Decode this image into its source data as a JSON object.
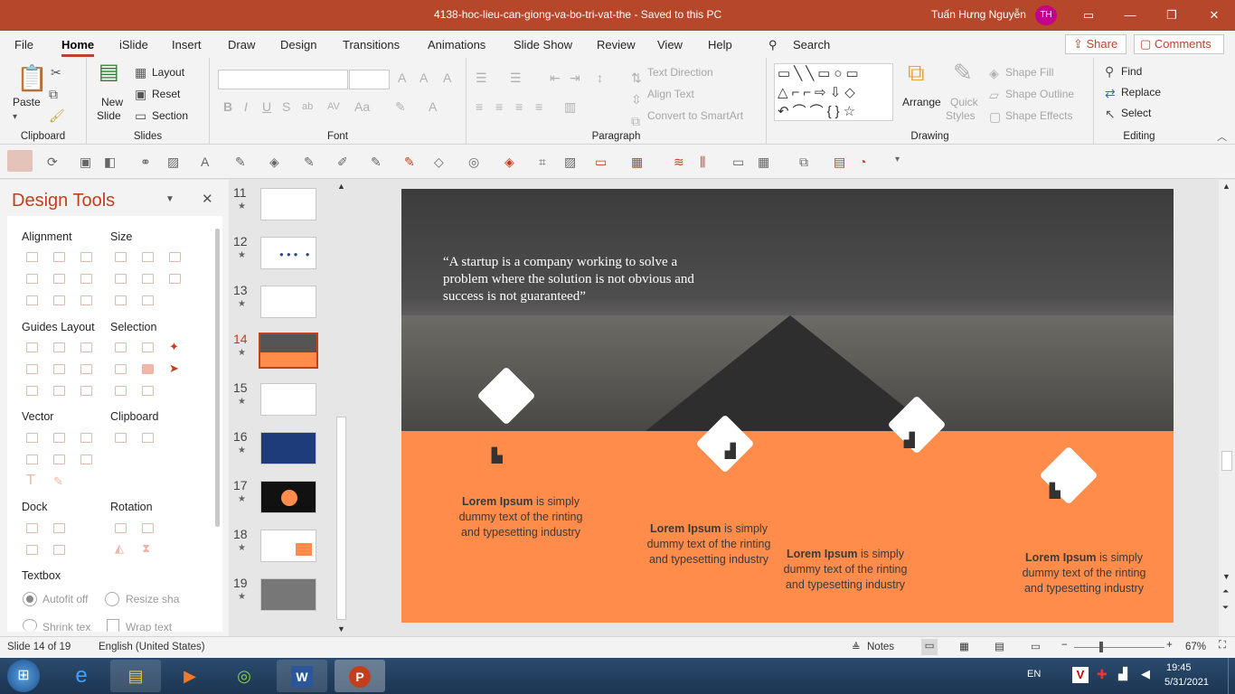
{
  "window": {
    "title": "4138-hoc-lieu-can-giong-va-bo-tri-vat-the  -  Saved to this PC",
    "user": "Tuấn Hưng Nguyễn",
    "initials": "TH"
  },
  "menu": {
    "tabs": [
      "File",
      "Home",
      "iSlide",
      "Insert",
      "Draw",
      "Design",
      "Transitions",
      "Animations",
      "Slide Show",
      "Review",
      "View",
      "Help"
    ],
    "search": "Search",
    "share": "Share",
    "comments": "Comments"
  },
  "ribbon": {
    "clipboard": {
      "paste": "Paste",
      "label": "Clipboard"
    },
    "slides": {
      "new_slide": "New",
      "new_slide2": "Slide",
      "layout": "Layout",
      "reset": "Reset",
      "section": "Section",
      "label": "Slides"
    },
    "font": {
      "label": "Font"
    },
    "paragraph": {
      "text_direction": "Text Direction",
      "align_text": "Align Text",
      "convert": "Convert to SmartArt",
      "label": "Paragraph"
    },
    "drawing": {
      "arrange": "Arrange",
      "quick": "Quick",
      "styles": "Styles",
      "shape_fill": "Shape Fill",
      "shape_outline": "Shape Outline",
      "shape_effects": "Shape Effects",
      "label": "Drawing"
    },
    "editing": {
      "find": "Find",
      "replace": "Replace",
      "select": "Select",
      "label": "Editing"
    }
  },
  "design_tools": {
    "title": "Design Tools",
    "sections": {
      "alignment": "Alignment",
      "size": "Size",
      "guides": "Guides Layout",
      "selection": "Selection",
      "vector": "Vector",
      "clipboard": "Clipboard",
      "dock": "Dock",
      "rotation": "Rotation",
      "textbox": "Textbox"
    },
    "autofit_off": "Autofit off",
    "resize": "Resize sha",
    "shrink": "Shrink tex",
    "wrap": "Wrap text"
  },
  "thumbnails": [
    {
      "n": "11"
    },
    {
      "n": "12"
    },
    {
      "n": "13"
    },
    {
      "n": "14"
    },
    {
      "n": "15"
    },
    {
      "n": "16"
    },
    {
      "n": "17"
    },
    {
      "n": "18"
    },
    {
      "n": "19"
    }
  ],
  "slide": {
    "quote": "“A startup is a company working to solve a problem where the solution is not obvious and success is not guaranteed”",
    "items": [
      {
        "bold": "Lorem Ipsum",
        "rest": " is simply dummy text of the rinting and typesetting industry"
      },
      {
        "bold": "Lorem Ipsum",
        "rest": " is simply dummy text of the rinting and typesetting industry"
      },
      {
        "bold": "Lorem Ipsum",
        "rest": " is simply dummy text of the rinting and typesetting industry"
      },
      {
        "bold": "Lorem Ipsum",
        "rest": " is simply dummy text of the rinting and typesetting industry"
      }
    ]
  },
  "status": {
    "slide": "Slide 14 of 19",
    "language": "English (United States)",
    "notes": "Notes",
    "zoom": "67%"
  },
  "taskbar": {
    "lang": "EN",
    "time": "19:45",
    "date": "5/31/2021"
  },
  "colors": {
    "accent": "#b7472a",
    "orange": "#ff8c4b"
  }
}
